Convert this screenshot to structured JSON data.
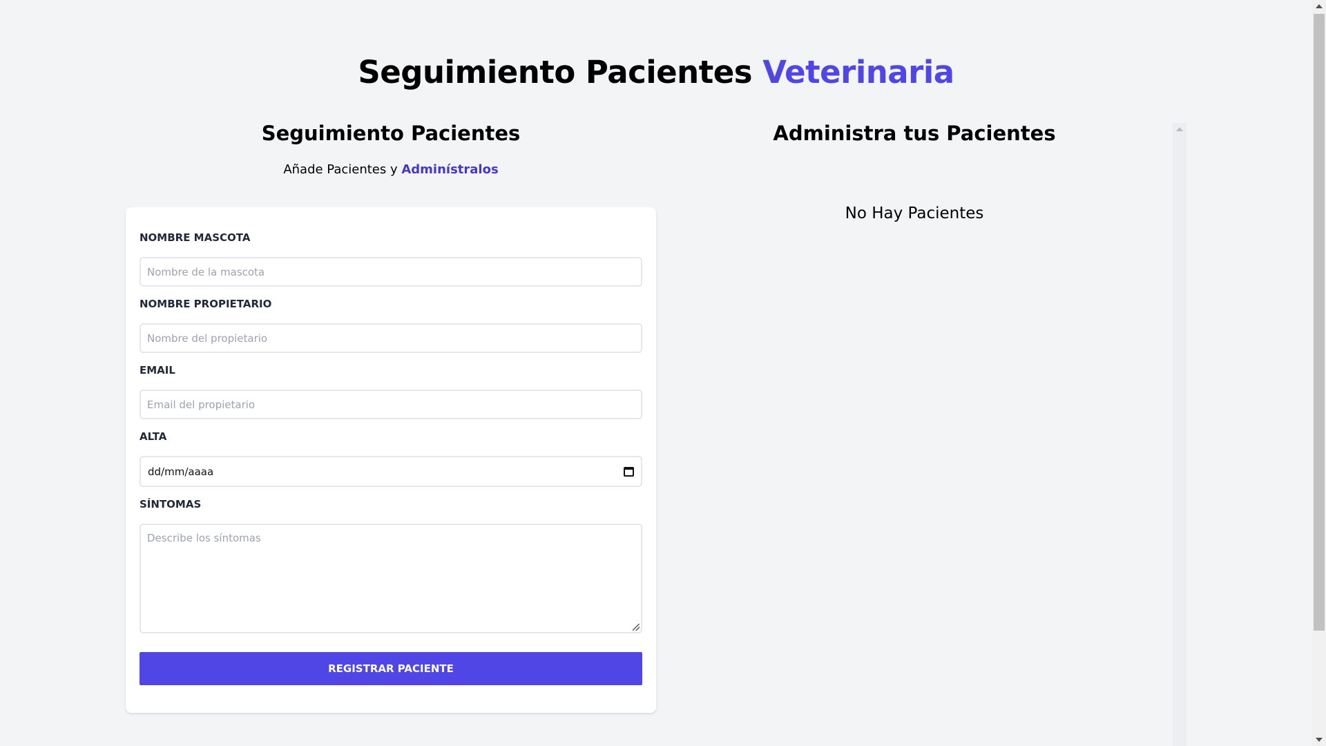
{
  "header": {
    "title_main": "Seguimiento Pacientes ",
    "title_accent": "Veterinaria"
  },
  "form_section": {
    "heading": "Seguimiento Pacientes",
    "subtitle_prefix": "Añade Pacientes y ",
    "subtitle_accent": "Adminístralos"
  },
  "form": {
    "pet_name": {
      "label": "Nombre Mascota",
      "placeholder": "Nombre de la mascota",
      "value": ""
    },
    "owner_name": {
      "label": "Nombre Propietario",
      "placeholder": "Nombre del propietario",
      "value": ""
    },
    "email": {
      "label": "Email",
      "placeholder": "Email del propietario",
      "value": ""
    },
    "discharge": {
      "label": "Alta",
      "value": "dd/mm/aaaa"
    },
    "symptoms": {
      "label": "Síntomas",
      "placeholder": "Describe los síntomas",
      "value": ""
    },
    "submit_label": "Registrar Paciente"
  },
  "list_section": {
    "heading": "Administra tus Pacientes",
    "empty_message": "No Hay Pacientes"
  },
  "colors": {
    "accent": "#4f46e5",
    "accent_dark": "#4338ca",
    "background": "#f3f4f6"
  },
  "icons": {
    "date_picker": "calendar-icon",
    "textarea_resize": "resize-handle-icon"
  }
}
